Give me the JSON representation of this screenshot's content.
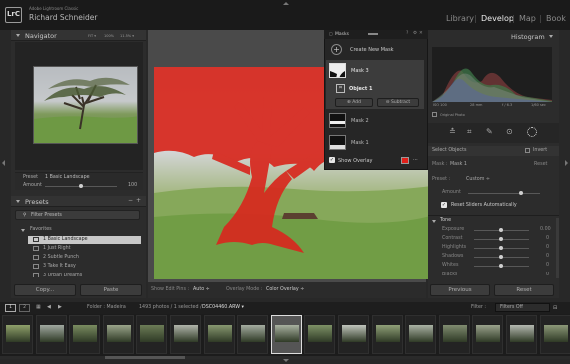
{
  "app": {
    "logo": "LrC",
    "name": "Adobe Lightroom Classic",
    "user": "Richard Schneider"
  },
  "modules": [
    {
      "label": "Library",
      "active": false
    },
    {
      "label": "Develop",
      "active": true
    },
    {
      "label": "Map",
      "active": false
    },
    {
      "label": "Book",
      "active": false
    }
  ],
  "navigator": {
    "title": "Navigator",
    "zoom_fit": "FIT ▾",
    "zoom_100": "100%",
    "zoom_custom": "11.5% ▾"
  },
  "preset_row": {
    "label": "Preset",
    "value": "1 Basic Landscape",
    "amount_label": "Amount",
    "amount_value": "100"
  },
  "presets": {
    "title": "Presets",
    "filter_placeholder": "Filter Presets",
    "group": "Favorites",
    "items": [
      {
        "label": "1 Basic Landscape",
        "selected": true
      },
      {
        "label": "1 Just Right",
        "selected": false
      },
      {
        "label": "2 Subtle Punch",
        "selected": false
      },
      {
        "label": "3 Take It Easy",
        "selected": false
      },
      {
        "label": "3 Urban Dreams",
        "selected": false
      }
    ]
  },
  "left_buttons": {
    "copy": "Copy...",
    "paste": "Paste"
  },
  "masks": {
    "title": "Masks",
    "create_new": "Create New Mask",
    "mask3": "Mask 3",
    "object1": "Object 1",
    "add": "Add",
    "subtract": "Subtract",
    "mask2": "Mask 2",
    "mask1": "Mask 1",
    "show_overlay": "Show Overlay",
    "overlay_color": "#e0201a"
  },
  "histogram": {
    "title": "Histogram",
    "iso": "ISO 100",
    "focal": "28 mm",
    "aperture": "f / 6.3",
    "shutter": "1/60 sec",
    "original_photo": "Original Photo"
  },
  "right": {
    "select_objects": "Select Objects",
    "invert": "Invert",
    "mask_label": "Mask :",
    "mask_value": "Mask 1",
    "reset": "Reset",
    "preset_label": "Preset :",
    "preset_value": "Custom ÷",
    "amount_label": "Amount",
    "reset_sliders": "Reset Sliders Automatically",
    "tone_title": "Tone",
    "sliders": [
      {
        "label": "Exposure",
        "value": "0.00",
        "pos": 0.5
      },
      {
        "label": "Contrast",
        "value": "0",
        "pos": 0.5
      },
      {
        "label": "Highlights",
        "value": "0",
        "pos": 0.5
      },
      {
        "label": "Shadows",
        "value": "0",
        "pos": 0.5
      },
      {
        "label": "Whites",
        "value": "0",
        "pos": 0.5
      },
      {
        "label": "Blacks",
        "value": "0",
        "pos": 0.5
      }
    ],
    "previous": "Previous",
    "reset_button": "Reset"
  },
  "toolbar": {
    "show_edit_pins_label": "Show Edit Pins :",
    "show_edit_pins_value": "Auto ÷",
    "overlay_mode_label": "Overlay Mode :",
    "overlay_mode_value": "Color Overlay ÷"
  },
  "filmstrip_bar": {
    "screen1": "1",
    "screen2": "2",
    "folder": "Folder : Madeira",
    "count": "1493 photos / 1 selected /",
    "filename": "DSC04460.ARW ▾",
    "filter_label": "Filter :",
    "filter_value": "Filters Off"
  },
  "thumbs": [
    "",
    "",
    "",
    "",
    "",
    "",
    "",
    "",
    "",
    "",
    "",
    "",
    "",
    "",
    "",
    "",
    ""
  ],
  "colors": {
    "accent": "#e0201a",
    "active_module": "#ececec"
  }
}
